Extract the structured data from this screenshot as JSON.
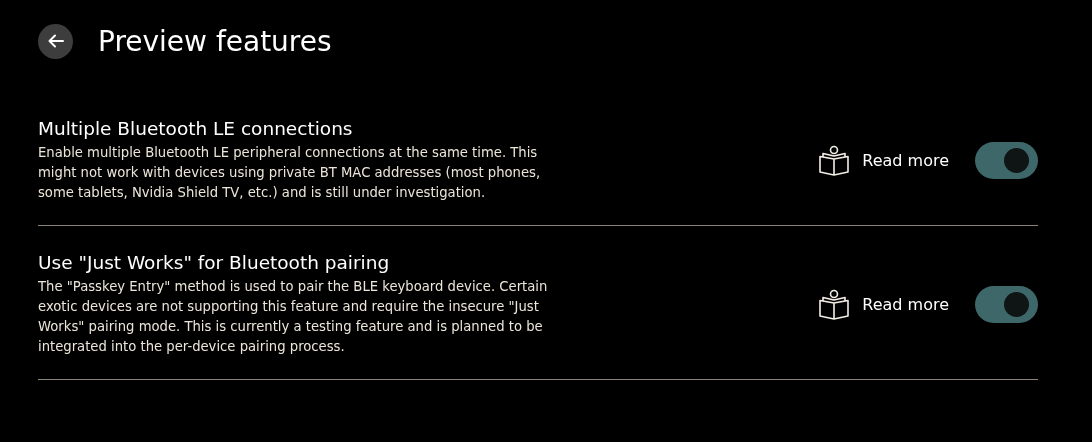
{
  "header": {
    "title": "Preview features"
  },
  "features": [
    {
      "title": "Multiple Bluetooth LE connections",
      "description": "Enable multiple Bluetooth LE peripheral connections at the same time. This might not work with devices using private BT MAC addresses (most phones, some tablets, Nvidia Shield TV, etc.) and is still under investigation.",
      "link": "Read more",
      "on": true
    },
    {
      "title": "Use \"Just Works\" for Bluetooth pairing",
      "description": "The \"Passkey Entry\" method is used to pair the BLE keyboard device. Certain exotic devices are not supporting this feature and require the insecure \"Just Works\" pairing mode. This is currently a testing feature and is planned to be integrated into the per-device pairing process.",
      "link": "Read more",
      "on": true
    }
  ]
}
